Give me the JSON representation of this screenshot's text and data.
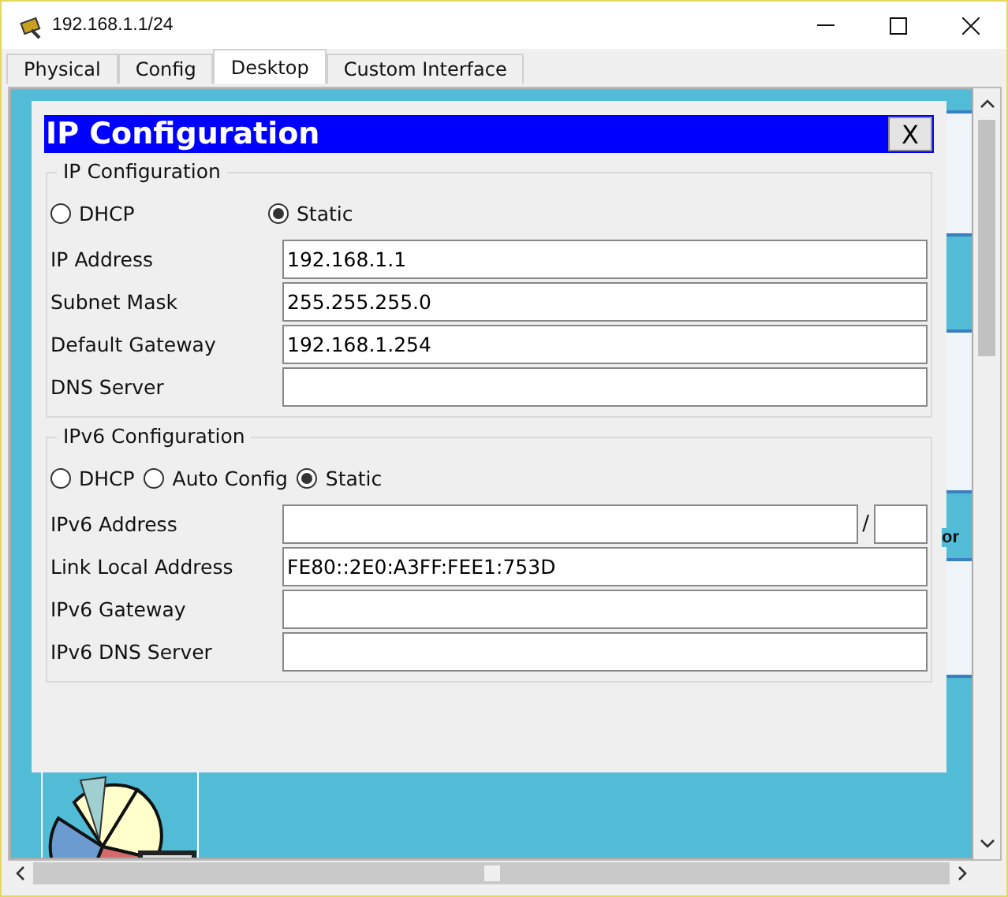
{
  "window": {
    "title": "192.168.1.1/24"
  },
  "tabs": [
    {
      "label": "Physical",
      "selected": false
    },
    {
      "label": "Config",
      "selected": false
    },
    {
      "label": "Desktop",
      "selected": true
    },
    {
      "label": "Custom Interface",
      "selected": false
    }
  ],
  "desktop": {
    "fragments": [
      "or"
    ]
  },
  "dialog": {
    "title": "IP Configuration",
    "close": "X",
    "sections": [
      {
        "kind": "spaced",
        "legend": "IP Configuration",
        "modes": [
          {
            "label": "DHCP",
            "selected": false
          },
          {
            "label": "Static",
            "selected": true
          }
        ],
        "fields": [
          {
            "kind": "text",
            "label": "IP Address",
            "value": "192.168.1.1"
          },
          {
            "kind": "text",
            "label": "Subnet Mask",
            "value": "255.255.255.0"
          },
          {
            "kind": "text",
            "label": "Default Gateway",
            "value": "192.168.1.254"
          },
          {
            "kind": "text",
            "label": "DNS Server"
          }
        ]
      },
      {
        "kind": "compact",
        "legend": "IPv6 Configuration",
        "modes": [
          {
            "label": "DHCP",
            "selected": false
          },
          {
            "label": "Auto Config",
            "selected": false
          },
          {
            "label": "Static",
            "selected": true
          }
        ],
        "fields": [
          {
            "kind": "prefix",
            "label": "IPv6 Address",
            "separator": "/"
          },
          {
            "kind": "text",
            "label": "Link Local Address",
            "value": "FE80::2E0:A3FF:FEE1:753D"
          },
          {
            "kind": "text",
            "label": "IPv6 Gateway"
          },
          {
            "kind": "text",
            "label": "IPv6 DNS Server"
          }
        ]
      }
    ]
  }
}
